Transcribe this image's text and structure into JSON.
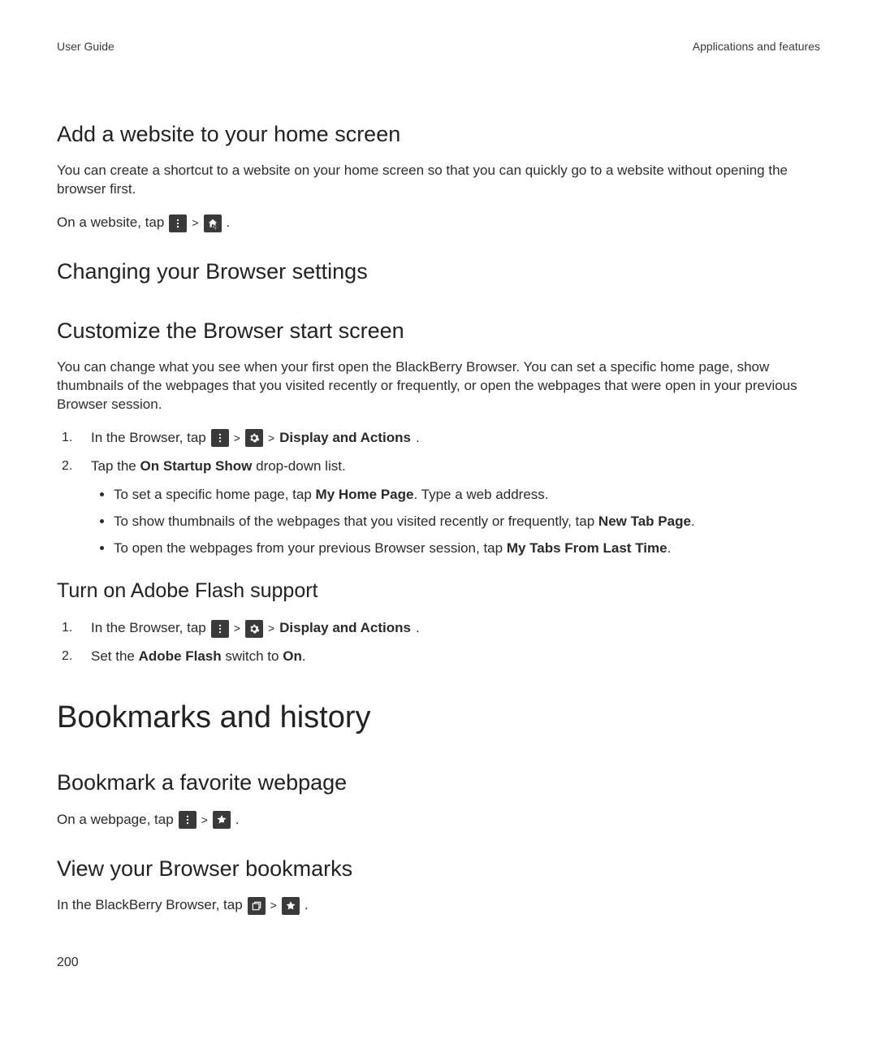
{
  "header": {
    "left": "User Guide",
    "right": "Applications and features"
  },
  "s1": {
    "title": "Add a website to your home screen",
    "para": "You can create a shortcut to a website on your home screen so that you can quickly go to a website without opening the browser first.",
    "line_pre": "On a website, tap",
    "sep": ">",
    "period": "."
  },
  "s2": {
    "title": "Changing your Browser settings"
  },
  "s3": {
    "title": "Customize the Browser start screen",
    "para": "You can change what you see when your first open the BlackBerry Browser. You can set a specific home page, show thumbnails of the webpages that you visited recently or frequently, or open the webpages that were open in your previous Browser session.",
    "step1_pre": "In the Browser, tap",
    "step1_bold": "Display and Actions",
    "step1_sep": ">",
    "step1_period": ".",
    "step2_pre": "Tap the ",
    "step2_bold": "On Startup Show",
    "step2_post": " drop-down list.",
    "b1_pre": "To set a specific home page, tap ",
    "b1_bold": "My Home Page",
    "b1_post": ". Type a web address.",
    "b2_pre": "To show thumbnails of the webpages that you visited recently or frequently, tap ",
    "b2_bold": "New Tab Page",
    "b2_post": ".",
    "b3_pre": "To open the webpages from your previous Browser session, tap ",
    "b3_bold": "My Tabs From Last Time",
    "b3_post": "."
  },
  "s4": {
    "title": "Turn on Adobe Flash support",
    "step1_pre": "In the Browser, tap",
    "step1_sep": ">",
    "step1_bold": "Display and Actions",
    "step1_period": ".",
    "step2_pre": "Set the ",
    "step2_bold": "Adobe Flash",
    "step2_mid": " switch to ",
    "step2_bold2": "On",
    "step2_post": "."
  },
  "s5": {
    "title": "Bookmarks and history"
  },
  "s6": {
    "title": "Bookmark a favorite webpage",
    "line_pre": "On a webpage, tap",
    "sep": ">",
    "period": "."
  },
  "s7": {
    "title": "View your Browser bookmarks",
    "line_pre": "In the BlackBerry Browser, tap",
    "sep": ">",
    "period": "."
  },
  "page_number": "200"
}
